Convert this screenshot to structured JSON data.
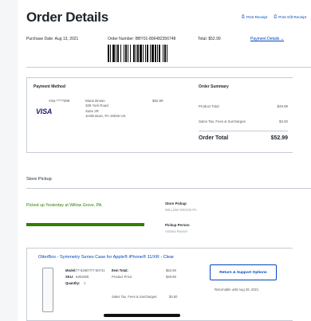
{
  "header": {
    "title": "Order Details",
    "print_receipt": "Print Receipt",
    "print_gift_receipt": "Print Gift Receipt"
  },
  "order": {
    "purchase_date": "Purchase Date: Aug 13, 2021",
    "order_number": "Order Number: BBY01-806482356748",
    "total": "Total: $52.99",
    "payment_details": "Payment Details"
  },
  "payment": {
    "heading": "Payment Method",
    "card_brand": "VISA",
    "card_mask": "Visa ****7598",
    "address_lines": [
      "Maria Brown",
      "309 York Road",
      "Suite 2R",
      "Jenkintown, PA 19046 US"
    ],
    "amount": "$52.99"
  },
  "summary": {
    "heading": "Order Summary",
    "rows": [
      {
        "label": "Product Total",
        "value": "$49.99"
      },
      {
        "label": "Sales Tax, Fees & Surcharges",
        "value": "$3.00"
      }
    ],
    "total_label": "Order Total",
    "total_value": "$52.99"
  },
  "pickup": {
    "title": "Store Pickup",
    "status": "Picked up Yesterday at Willow Grove, PA.",
    "progress_fraction": 1.0,
    "store_label": "Store Pickup",
    "store_value": "WILLOW GROVE PA",
    "person_label": "Pickup Person",
    "person_value": "Andrea Reuser"
  },
  "item": {
    "name": "OtterBox - Symmetry Series Case for Apple® iPhone® 11/XR - Clear",
    "model_label": "Model:",
    "model_value": "77-62607/77-60741",
    "sku_label": "SKU:",
    "sku_value": "6361606",
    "qty_label": "Quantity:",
    "qty_value": "1",
    "item_total_label": "Item Total:",
    "item_total_value": "$52.99",
    "product_price_label": "Product Price:",
    "product_price_value": "$49.99",
    "tax_label": "Sales Tax, Fees & Surcharges:",
    "tax_value": "$3.00",
    "return_button": "Return & Support Options",
    "return_note": "Returnable until Aug 28, 2021."
  },
  "colors": {
    "link": "#0046be",
    "success": "#318000",
    "border": "#c5cbd5",
    "text": "#1d252c"
  }
}
